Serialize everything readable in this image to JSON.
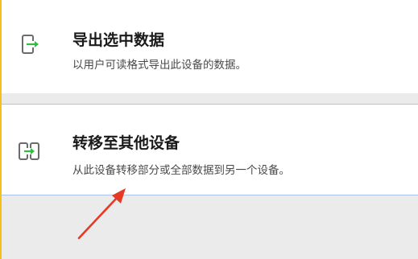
{
  "options": [
    {
      "title": "导出选中数据",
      "description": "以用户可读格式导出此设备的数据。",
      "icon": "device-export-icon"
    },
    {
      "title": "转移至其他设备",
      "description": "从此设备转移部分或全部数据到另一个设备。",
      "icon": "device-transfer-icon"
    }
  ],
  "colors": {
    "accent_green": "#2fbf3c",
    "icon_gray": "#6b6b6b",
    "annotation_red": "#e53a23",
    "left_border": "#f2c21b",
    "selected_border": "#a9c4e8"
  }
}
